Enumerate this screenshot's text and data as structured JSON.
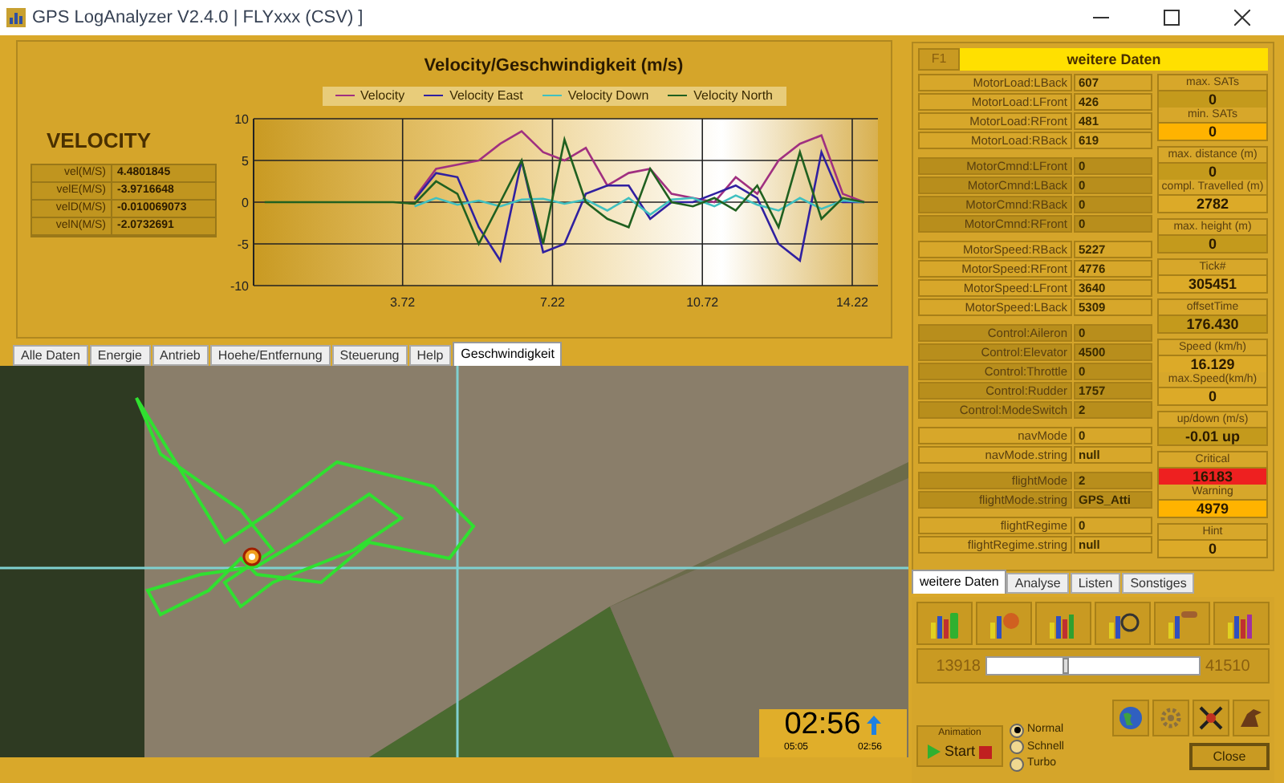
{
  "window": {
    "title": "GPS LogAnalyzer V2.4.0  | FLYxxx (CSV) ]"
  },
  "velocity_panel": {
    "heading": "VELOCITY",
    "rows": [
      {
        "label": "vel(M/S)",
        "value": "4.4801845"
      },
      {
        "label": "velE(M/S)",
        "value": "-3.9716648"
      },
      {
        "label": "velD(M/S)",
        "value": "-0.010069073"
      },
      {
        "label": "velN(M/S)",
        "value": "-2.0732691"
      }
    ]
  },
  "chart_data": {
    "type": "line",
    "grid": true,
    "title": "Velocity/Geschwindigkeit (m/s)",
    "x": [
      0.5,
      1,
      1.5,
      2,
      2.5,
      3,
      3.5,
      4,
      4.5,
      5,
      5.5,
      6,
      6.5,
      7,
      7.5,
      8,
      8.5,
      9,
      9.5,
      10,
      10.5,
      11,
      11.5,
      12,
      12.5,
      13,
      13.5,
      14,
      14.5
    ],
    "xlim": [
      0.24,
      14.82
    ],
    "ylim": [
      -10,
      10
    ],
    "xticks": [
      3.72,
      7.22,
      10.72,
      14.22
    ],
    "yticks": [
      -10,
      -5,
      0,
      5,
      10
    ],
    "series": [
      {
        "name": "Velocity",
        "color": "#a03080",
        "values": [
          null,
          null,
          null,
          null,
          null,
          null,
          null,
          0.5,
          4,
          4.5,
          5,
          7,
          8.5,
          6,
          5,
          6.5,
          2,
          3.5,
          4,
          1,
          0.5,
          0,
          3,
          1,
          5,
          7,
          8,
          1,
          0
        ]
      },
      {
        "name": "Velocity East",
        "color": "#3020a0",
        "values": [
          null,
          null,
          null,
          null,
          null,
          null,
          null,
          0.3,
          3.5,
          3,
          -3,
          -7,
          5,
          -6,
          -5,
          1,
          2,
          2,
          -2,
          0,
          0,
          1,
          2,
          0.5,
          -5,
          -7,
          6,
          0,
          0
        ]
      },
      {
        "name": "Velocity Down",
        "color": "#40c0c0",
        "values": [
          null,
          null,
          null,
          null,
          null,
          null,
          null,
          -0.5,
          0.5,
          -0.3,
          0.2,
          -0.5,
          0.3,
          0.4,
          -0.2,
          0.3,
          -1,
          0.5,
          -1.5,
          0.3,
          0.5,
          -0.5,
          0.8,
          -0.3,
          -1,
          0.5,
          -0.8,
          0.2,
          0
        ]
      },
      {
        "name": "Velocity North",
        "color": "#206020",
        "values": [
          0,
          0,
          0,
          0,
          0,
          0,
          0,
          -0.2,
          2.5,
          1,
          -5,
          0,
          5,
          -5,
          7.5,
          0,
          -2,
          -3,
          4,
          0,
          -0.5,
          0.5,
          -1,
          2,
          -3,
          6,
          -2,
          0.5,
          0
        ]
      }
    ]
  },
  "tabs": [
    {
      "label": "Alle Daten",
      "selected": false
    },
    {
      "label": "Energie",
      "selected": false
    },
    {
      "label": "Antrieb",
      "selected": false
    },
    {
      "label": "Hoehe/Entfernung",
      "selected": false
    },
    {
      "label": "Steuerung",
      "selected": false
    },
    {
      "label": "Help",
      "selected": false
    },
    {
      "label": "Geschwindigkeit",
      "selected": true
    }
  ],
  "map": {
    "timer": {
      "time": "02:56",
      "total": "05:05",
      "elapsed": "02:56"
    }
  },
  "data_panel": {
    "key": "F1",
    "title": "weitere Daten",
    "groups": [
      [
        {
          "label": "MotorLoad:LBack",
          "value": "607"
        },
        {
          "label": "MotorLoad:LFront",
          "value": "426"
        },
        {
          "label": "MotorLoad:RFront",
          "value": "481"
        },
        {
          "label": "MotorLoad:RBack",
          "value": "619"
        }
      ],
      [
        {
          "label": "MotorCmnd:LFront",
          "value": "0"
        },
        {
          "label": "MotorCmnd:LBack",
          "value": "0"
        },
        {
          "label": "MotorCmnd:RBack",
          "value": "0"
        },
        {
          "label": "MotorCmnd:RFront",
          "value": "0"
        }
      ],
      [
        {
          "label": "MotorSpeed:RBack",
          "value": "5227"
        },
        {
          "label": "MotorSpeed:RFront",
          "value": "4776"
        },
        {
          "label": "MotorSpeed:LFront",
          "value": "3640"
        },
        {
          "label": "MotorSpeed:LBack",
          "value": "5309"
        }
      ],
      [
        {
          "label": "Control:Aileron",
          "value": "0"
        },
        {
          "label": "Control:Elevator",
          "value": "4500"
        },
        {
          "label": "Control:Throttle",
          "value": "0"
        },
        {
          "label": "Control:Rudder",
          "value": "1757"
        },
        {
          "label": "Control:ModeSwitch",
          "value": "2"
        }
      ],
      [
        {
          "label": "navMode",
          "value": "0"
        },
        {
          "label": "navMode.string",
          "value": "null"
        }
      ],
      [
        {
          "label": "flightMode",
          "value": "2"
        },
        {
          "label": "flightMode.string",
          "value": "GPS_Atti"
        }
      ],
      [
        {
          "label": "flightRegime",
          "value": "0"
        },
        {
          "label": "flightRegime.string",
          "value": "null"
        }
      ]
    ],
    "stats": [
      [
        {
          "label": "max. SATs",
          "value": "0",
          "color": "#c49a1c"
        },
        {
          "label": "min. SATs",
          "value": "0",
          "color": "#ffb300"
        }
      ],
      [
        {
          "label": "max. distance (m)",
          "value": "0",
          "color": "#c49a1c"
        },
        {
          "label": "compl. Travelled (m)",
          "value": "2782",
          "color": "#dcaa28"
        }
      ],
      [
        {
          "label": "max. height (m)",
          "value": "0",
          "color": "#c49a1c"
        }
      ],
      [
        {
          "label": "Tick#",
          "value": "305451",
          "color": "#dcaa28"
        }
      ],
      [
        {
          "label": "offsetTime",
          "value": "176.430",
          "color": "#c49a1c"
        }
      ],
      [
        {
          "label": "Speed (km/h)",
          "value": "16.129",
          "color": "#dcaa28"
        },
        {
          "label": "max.Speed(km/h)",
          "value": "0",
          "color": "#dcaa28"
        }
      ],
      [
        {
          "label": "up/down (m/s)",
          "value": "-0.01 up",
          "color": "#c49a1c"
        }
      ],
      [
        {
          "label": "Critical",
          "value": "16183",
          "color": "#ee2020"
        },
        {
          "label": "Warning",
          "value": "4979",
          "color": "#ffb300"
        }
      ],
      [
        {
          "label": "Hint",
          "value": "0",
          "color": "#dcaa28"
        }
      ]
    ]
  },
  "side_tabs": [
    {
      "label": "weitere Daten",
      "selected": true
    },
    {
      "label": "Analyse",
      "selected": false
    },
    {
      "label": "Listen",
      "selected": false
    },
    {
      "label": "Sonstiges",
      "selected": false
    }
  ],
  "range": {
    "min": "13918",
    "max": "41510",
    "level": 0.37
  },
  "animation": {
    "label": "Animation",
    "button": "Start"
  },
  "speed_options": [
    {
      "label": "Normal",
      "selected": true
    },
    {
      "label": "Schnell",
      "selected": false
    },
    {
      "label": "Turbo",
      "selected": false
    }
  ],
  "close_button": "Close"
}
